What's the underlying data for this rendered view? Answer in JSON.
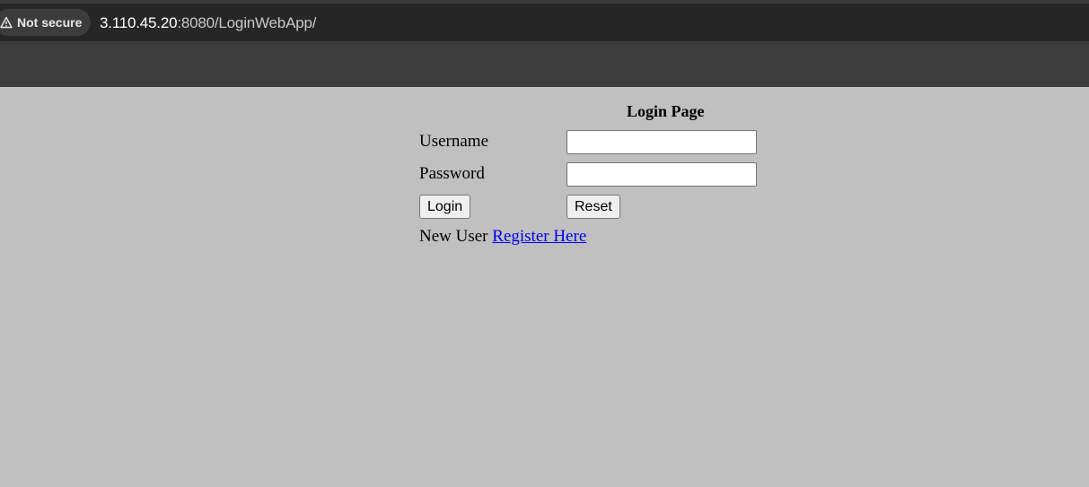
{
  "browser": {
    "security_label": "Not secure",
    "security_icon": "warning-triangle-icon",
    "url_host": "3.110.45.20",
    "url_rest": ":8080/LoginWebApp/"
  },
  "login": {
    "title": "Login Page",
    "username_label": "Username",
    "username_value": "",
    "password_label": "Password",
    "password_value": "",
    "login_button": "Login",
    "reset_button": "Reset",
    "new_user_text": "New User",
    "register_link": "Register Here"
  },
  "colors": {
    "page_background": "#c0c0c0",
    "address_bar": "#262626",
    "toolbar": "#3c3c3c",
    "link": "#0000ee"
  }
}
